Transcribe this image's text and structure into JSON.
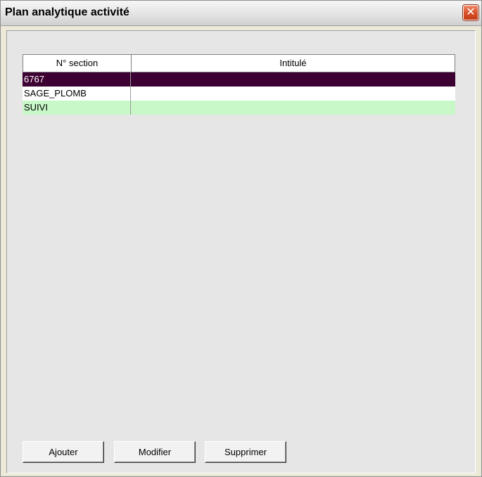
{
  "window": {
    "title": "Plan analytique activité",
    "close_symbol": "✕"
  },
  "grid": {
    "columns": [
      "N° section",
      "Intitulé"
    ],
    "rows": [
      {
        "section": "6767",
        "intitule": "",
        "style": "selected"
      },
      {
        "section": "SAGE_PLOMB",
        "intitule": "",
        "style": "white"
      },
      {
        "section": "SUIVI",
        "intitule": "",
        "style": "green"
      }
    ]
  },
  "buttons": {
    "add": "Ajouter",
    "edit": "Modifier",
    "delete": "Supprimer"
  },
  "colors": {
    "selected_row": "#3d0032",
    "green_row": "#c8f7c8",
    "close_button": "#d9522b"
  }
}
